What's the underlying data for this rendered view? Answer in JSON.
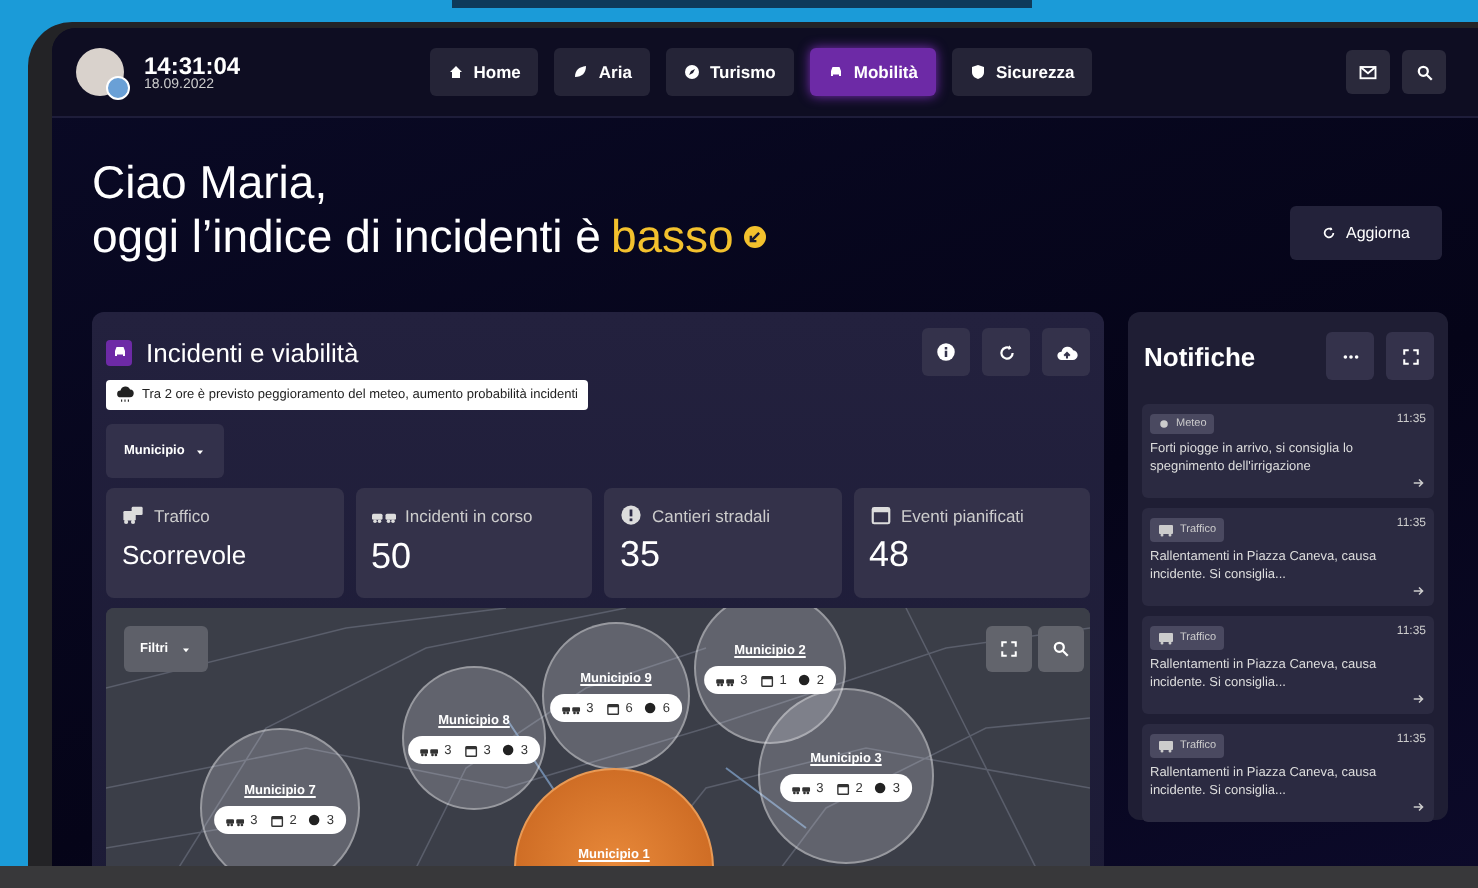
{
  "header": {
    "time": "14:31:04",
    "date": "18.09.2022",
    "tabs": [
      {
        "label": "Home",
        "kind": "home",
        "selected": false
      },
      {
        "label": "Aria",
        "kind": "leaf",
        "selected": false
      },
      {
        "label": "Turismo",
        "kind": "compass",
        "selected": false
      },
      {
        "label": "Mobilità",
        "kind": "car",
        "selected": true
      },
      {
        "label": "Sicurezza",
        "kind": "shield",
        "selected": false
      }
    ]
  },
  "greeting": {
    "line_1": "Ciao Maria,",
    "line_2": "oggi l’indice di incidenti è",
    "index_word": "basso"
  },
  "refresh_button": "Aggiorna",
  "panel": {
    "title": "Incidenti e viabilità",
    "alert": "Tra 2 ore è previsto peggioramento del meteo, aumento probabilità incidenti",
    "dropdown": "Municipio",
    "stats": [
      {
        "kind": "traffic",
        "label": "Traffico",
        "value": "Scorrevole"
      },
      {
        "kind": "incidents",
        "label": "Incidenti in corso",
        "value": "50"
      },
      {
        "kind": "works",
        "label": "Cantieri stradali",
        "value": "35"
      },
      {
        "kind": "events",
        "label": "Eventi pianificati",
        "value": "48"
      }
    ]
  },
  "map": {
    "filter_button": "Filtri",
    "districts": [
      {
        "name": "Municipio 2",
        "kind": "normal",
        "incidents": "3",
        "events": "1",
        "works": "2"
      },
      {
        "name": "Municipio 9",
        "kind": "normal",
        "incidents": "3",
        "events": "6",
        "works": "6"
      },
      {
        "name": "Municipio 8",
        "kind": "normal",
        "incidents": "3",
        "events": "3",
        "works": "3"
      },
      {
        "name": "Municipio 3",
        "kind": "normal",
        "incidents": "3",
        "events": "2",
        "works": "3"
      },
      {
        "name": "Municipio 7",
        "kind": "normal",
        "incidents": "3",
        "events": "2",
        "works": "3"
      },
      {
        "name": "Municipio 1",
        "kind": "highlight"
      }
    ]
  },
  "notifications": {
    "title": "Notifiche",
    "items": [
      {
        "kind": "weather",
        "tag": "Meteo",
        "time": "11:35",
        "text": "Forti piogge in arrivo, si consiglia lo spegnimento dell'irrigazione"
      },
      {
        "kind": "traffic",
        "tag": "Traffico",
        "time": "11:35",
        "text": "Rallentamenti in Piazza Caneva, causa incidente. Si consiglia..."
      },
      {
        "kind": "traffic",
        "tag": "Traffico",
        "time": "11:35",
        "text": "Rallentamenti in Piazza Caneva, causa incidente. Si consiglia..."
      },
      {
        "kind": "traffic",
        "tag": "Traffico",
        "time": "11:35",
        "text": "Rallentamenti in Piazza Caneva, causa incidente. Si consiglia..."
      }
    ]
  }
}
